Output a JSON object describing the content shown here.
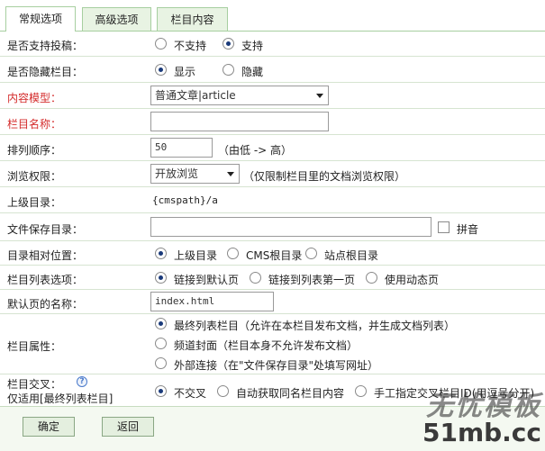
{
  "tabs": [
    "常规选项",
    "高级选项",
    "栏目内容"
  ],
  "rows": {
    "contribute": {
      "label": "是否支持投稿：",
      "options": [
        "不支持",
        "支持"
      ]
    },
    "hidden": {
      "label": "是否隐藏栏目：",
      "options": [
        "显示",
        "隐藏"
      ]
    },
    "model": {
      "label": "内容模型：",
      "value": "普通文章|article"
    },
    "name": {
      "label": "栏目名称：",
      "value": ""
    },
    "order": {
      "label": "排列顺序：",
      "value": "50",
      "hint": "（由低 -> 高）"
    },
    "access": {
      "label": "浏览权限：",
      "value": "开放浏览",
      "hint": "（仅限制栏目里的文档浏览权限）"
    },
    "parent": {
      "label": "上级目录：",
      "value": "{cmspath}/a"
    },
    "save_dir": {
      "label": "文件保存目录：",
      "value": "",
      "checkbox_label": "拼音"
    },
    "relative": {
      "label": "目录相对位置：",
      "options": [
        "上级目录",
        "CMS根目录",
        "站点根目录"
      ]
    },
    "list_option": {
      "label": "栏目列表选项：",
      "options": [
        "链接到默认页",
        "链接到列表第一页",
        "使用动态页"
      ]
    },
    "default_page": {
      "label": "默认页的名称：",
      "value": "index.html"
    },
    "attribute": {
      "label": "栏目属性：",
      "options": [
        "最终列表栏目（允许在本栏目发布文档，并生成文档列表）",
        "频道封面（栏目本身不允许发布文档）",
        "外部连接（在\"文件保存目录\"处填写网址）"
      ]
    },
    "cross": {
      "label": "栏目交叉：",
      "label2": "仅适用[最终列表栏目]",
      "help": "?",
      "options": [
        "不交叉",
        "自动获取同名栏目内容",
        "手工指定交叉栏目ID(用逗号分开)"
      ]
    }
  },
  "buttons": {
    "ok": "确定",
    "back": "返回"
  },
  "watermark": {
    "cn": "无忧模板",
    "en": "51mb.cc"
  }
}
